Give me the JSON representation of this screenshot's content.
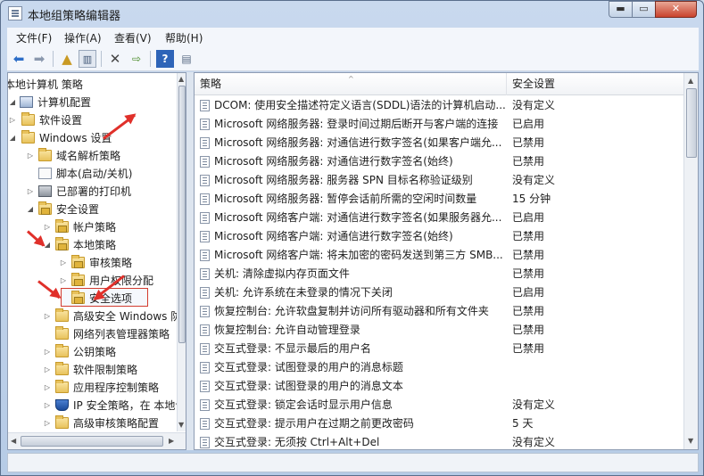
{
  "window": {
    "title": "本地组策略编辑器",
    "min": "▬",
    "max": "▭",
    "close": "✕"
  },
  "menu": [
    "文件(F)",
    "操作(A)",
    "查看(V)",
    "帮助(H)"
  ],
  "toolbar": {
    "back_icon": "arrow-left-icon",
    "forward_icon": "arrow-right-icon",
    "up_icon": "folder-up-icon",
    "show_tree_icon": "show-hide-tree-icon",
    "delete_icon": "delete-icon",
    "export_icon": "export-list-icon",
    "help_icon": "help-icon",
    "properties_icon": "properties-icon"
  },
  "tree": {
    "items": [
      {
        "label": "本地计算机 策略"
      },
      {
        "label": "计算机配置"
      },
      {
        "label": "软件设置"
      },
      {
        "label": "Windows 设置"
      },
      {
        "label": "域名解析策略"
      },
      {
        "label": "脚本(启动/关机)"
      },
      {
        "label": "已部署的打印机"
      },
      {
        "label": "安全设置"
      },
      {
        "label": "帐户策略"
      },
      {
        "label": "本地策略"
      },
      {
        "label": "审核策略"
      },
      {
        "label": "用户权限分配"
      },
      {
        "label": "安全选项"
      },
      {
        "label": "高级安全 Windows 防火墙"
      },
      {
        "label": "网络列表管理器策略"
      },
      {
        "label": "公钥策略"
      },
      {
        "label": "软件限制策略"
      },
      {
        "label": "应用程序控制策略"
      },
      {
        "label": "IP 安全策略，在 本地计算机"
      },
      {
        "label": "高级审核策略配置"
      }
    ],
    "collapsed_glyph": "▷",
    "expanded_glyph": "◢"
  },
  "columns": {
    "policy": "策略",
    "setting": "安全设置"
  },
  "rows": [
    {
      "name": "DCOM: 使用安全描述符定义语言(SDDL)语法的计算机启动...",
      "value": "没有定义"
    },
    {
      "name": "Microsoft 网络服务器: 登录时间过期后断开与客户端的连接",
      "value": "已启用"
    },
    {
      "name": "Microsoft 网络服务器: 对通信进行数字签名(如果客户端允...",
      "value": "已禁用"
    },
    {
      "name": "Microsoft 网络服务器: 对通信进行数字签名(始终)",
      "value": "已禁用"
    },
    {
      "name": "Microsoft 网络服务器: 服务器 SPN 目标名称验证级别",
      "value": "没有定义"
    },
    {
      "name": "Microsoft 网络服务器: 暂停会话前所需的空闲时间数量",
      "value": "15 分钟"
    },
    {
      "name": "Microsoft 网络客户端: 对通信进行数字签名(如果服务器允...",
      "value": "已启用"
    },
    {
      "name": "Microsoft 网络客户端: 对通信进行数字签名(始终)",
      "value": "已禁用"
    },
    {
      "name": "Microsoft 网络客户端: 将未加密的密码发送到第三方 SMB...",
      "value": "已禁用"
    },
    {
      "name": "关机: 清除虚拟内存页面文件",
      "value": "已禁用"
    },
    {
      "name": "关机: 允许系统在未登录的情况下关闭",
      "value": "已启用"
    },
    {
      "name": "恢复控制台: 允许软盘复制并访问所有驱动器和所有文件夹",
      "value": "已禁用"
    },
    {
      "name": "恢复控制台: 允许自动管理登录",
      "value": "已禁用"
    },
    {
      "name": "交互式登录: 不显示最后的用户名",
      "value": "已禁用"
    },
    {
      "name": "交互式登录: 试图登录的用户的消息标题",
      "value": ""
    },
    {
      "name": "交互式登录: 试图登录的用户的消息文本",
      "value": ""
    },
    {
      "name": "交互式登录: 锁定会话时显示用户信息",
      "value": "没有定义"
    },
    {
      "name": "交互式登录: 提示用户在过期之前更改密码",
      "value": "5 天"
    },
    {
      "name": "交互式登录: 无须按 Ctrl+Alt+Del",
      "value": "没有定义"
    }
  ],
  "scroll": {
    "up": "▲",
    "down": "▼",
    "left": "◀",
    "right": "▶",
    "sort": "^"
  },
  "colors": {
    "annotation": "#e0302a",
    "selection_box": "#d23b2f"
  }
}
